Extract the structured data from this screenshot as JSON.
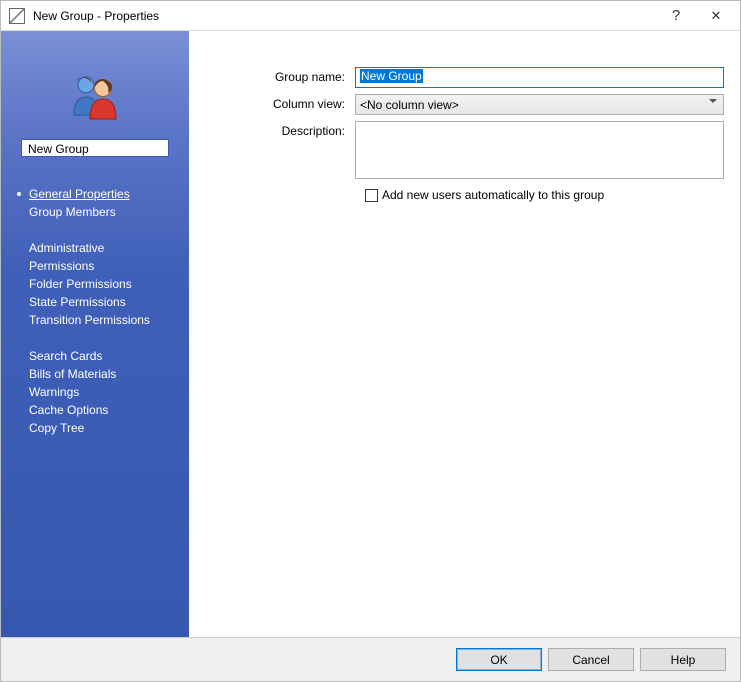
{
  "titlebar": {
    "title": "New Group - Properties",
    "help_symbol": "?",
    "close_symbol": "✕"
  },
  "sidebar": {
    "group_name_display": "New Group",
    "sections": [
      {
        "items": [
          {
            "label": "General Properties",
            "selected": true
          },
          {
            "label": "Group Members",
            "selected": false
          }
        ]
      },
      {
        "items": [
          {
            "label": "Administrative Permissions",
            "selected": false
          },
          {
            "label": "Folder Permissions",
            "selected": false
          },
          {
            "label": "State Permissions",
            "selected": false
          },
          {
            "label": "Transition Permissions",
            "selected": false
          }
        ]
      },
      {
        "items": [
          {
            "label": "Search Cards",
            "selected": false
          },
          {
            "label": "Bills of Materials",
            "selected": false
          },
          {
            "label": "Warnings",
            "selected": false
          },
          {
            "label": "Cache Options",
            "selected": false
          },
          {
            "label": "Copy Tree",
            "selected": false
          }
        ]
      }
    ]
  },
  "form": {
    "group_name_label": "Group name:",
    "group_name_value": "New Group",
    "column_view_label": "Column view:",
    "column_view_value": "<No column view>",
    "description_label": "Description:",
    "description_value": "",
    "checkbox_label": "Add new users automatically to this group",
    "checkbox_checked": false
  },
  "footer": {
    "ok": "OK",
    "cancel": "Cancel",
    "help": "Help"
  }
}
